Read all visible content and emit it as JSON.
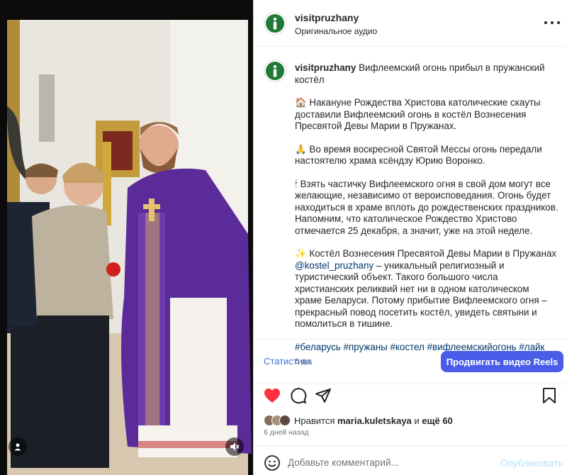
{
  "post": {
    "username": "visitpruzhany",
    "audio_label": "Оригинальное аудио",
    "caption_title": "Вифлеемский огонь прибыл в пружанский костёл",
    "paragraphs": [
      "🏠 Накануне Рождества Христова католические скауты доставили Вифлеемский огонь в костёл Вознесения Пресвятой Девы Марии в Пружанах.",
      "🙏 Во время воскресной Святой Мессы огонь передали настоятелю храма ксёндзу Юрию Воронко.",
      "🕯 Взять частичку Вифлеемского огня в свой дом могут все желающие, независимо от вероисповедания. Огонь будет находиться в храме вплоть до рождественских праздников. Напомним, что католическое Рождество Христово отмечается 25 декабря, а значит, уже на этой неделе."
    ],
    "p4_start": "✨ Костёл Вознесения Пресвятой Девы Марии в Пружанах ",
    "p4_mention": "@kostel_pruzhany",
    "p4_end": " – уникальный религиозный и туристический объект. Такого большого числа христианских реликвий нет ни в одном католическом храме Беларуси. Потому прибытие Вифлеемского огня – прекрасный повод посетить костёл, увидеть святыни и помолиться в тишине.",
    "hashtags": "#беларусь #пружаны #костел #вифлеемскийогонь #лайк",
    "caption_time": "6 дн."
  },
  "stats": {
    "link_label": "Статистика",
    "promote_label": "Продвигать видео Reels"
  },
  "likes": {
    "prefix": "Нравится ",
    "user": "maria.kuletskaya",
    "middle": " и ",
    "rest": "ещё 60"
  },
  "date_label": "6 дней назад",
  "comment": {
    "placeholder": "Добавьте комментарий...",
    "publish_label": "Опубликовать"
  },
  "colors": {
    "accent": "#4a5de8",
    "like_red": "#ff3040",
    "avatar_green": "#1e7a35",
    "vestment_purple": "#5b2b9a"
  },
  "icons": {
    "avatar": "info-i-icon",
    "more": "more-horizontal-icon",
    "like": "heart-filled-icon",
    "comment": "comment-bubble-icon",
    "share": "paper-plane-icon",
    "save": "bookmark-icon",
    "emoji": "smiley-icon",
    "media_user": "user-tag-icon",
    "media_audio": "speaker-muted-icon"
  }
}
